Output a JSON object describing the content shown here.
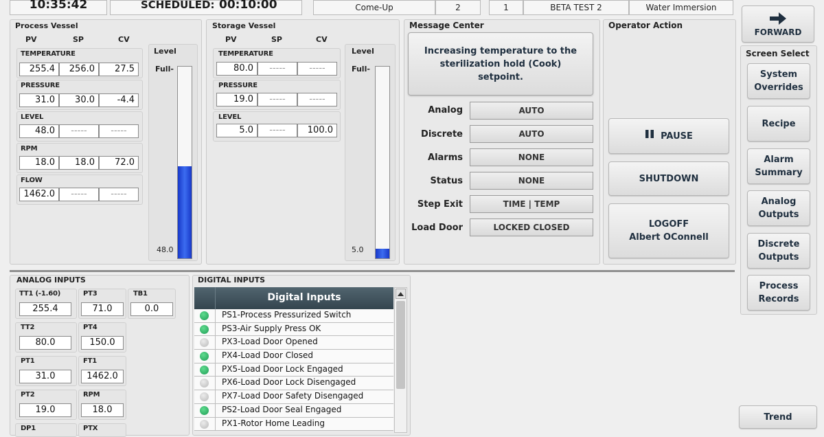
{
  "header": {
    "clock": "10:35:42",
    "scheduled_label": "SCHEDULED:",
    "scheduled_value": "00:10:00",
    "phase": "Come-Up",
    "phase_num": "2",
    "cycle_num": "1",
    "product": "BETA TEST 2",
    "process": "Water Immersion"
  },
  "process_vessel": {
    "title": "Process Vessel",
    "cols": [
      "PV",
      "SP",
      "CV"
    ],
    "rows": [
      {
        "label": "TEMPERATURE",
        "pv": "255.4",
        "sp": "256.0",
        "cv": "27.5"
      },
      {
        "label": "PRESSURE",
        "pv": "31.0",
        "sp": "30.0",
        "cv": "-4.4"
      },
      {
        "label": "LEVEL",
        "pv": "48.0",
        "sp": "-----",
        "cv": "-----"
      },
      {
        "label": "RPM",
        "pv": "18.0",
        "sp": "18.0",
        "cv": "72.0"
      },
      {
        "label": "FLOW",
        "pv": "1462.0",
        "sp": "-----",
        "cv": "-----"
      }
    ],
    "level_title": "Level",
    "level_full": "Full-",
    "level_value": "48.0",
    "level_fraction": 0.48
  },
  "storage_vessel": {
    "title": "Storage Vessel",
    "cols": [
      "PV",
      "SP",
      "CV"
    ],
    "rows": [
      {
        "label": "TEMPERATURE",
        "pv": "80.0",
        "sp": "-----",
        "cv": "-----"
      },
      {
        "label": "PRESSURE",
        "pv": "19.0",
        "sp": "-----",
        "cv": "-----"
      },
      {
        "label": "LEVEL",
        "pv": "5.0",
        "sp": "-----",
        "cv": "100.0"
      }
    ],
    "level_title": "Level",
    "level_full": "Full-",
    "level_value": "5.0",
    "level_fraction": 0.05
  },
  "message_center": {
    "title": "Message Center",
    "message_line1": "Increasing temperature to the",
    "message_line2": "sterilization hold (Cook)",
    "message_line3": "setpoint.",
    "status": [
      {
        "label": "Analog",
        "value": "AUTO"
      },
      {
        "label": "Discrete",
        "value": "AUTO"
      },
      {
        "label": "Alarms",
        "value": "NONE"
      },
      {
        "label": "Status",
        "value": "NONE"
      },
      {
        "label": "Step Exit",
        "value": "TIME | TEMP"
      },
      {
        "label": "Load Door",
        "value": "LOCKED CLOSED"
      }
    ]
  },
  "operator_action": {
    "title": "Operator Action",
    "pause_label": "PAUSE",
    "shutdown_label": "SHUTDOWN",
    "logoff_label": "LOGOFF",
    "user_name": "Albert OConnell"
  },
  "nav": {
    "forward_label": "FORWARD",
    "screen_select_title": "Screen Select",
    "buttons": [
      {
        "line1": "System",
        "line2": "Overrides"
      },
      {
        "line1": "Recipe",
        "line2": ""
      },
      {
        "line1": "Alarm",
        "line2": "Summary"
      },
      {
        "line1": "Analog",
        "line2": "Outputs"
      },
      {
        "line1": "Discrete",
        "line2": "Outputs"
      },
      {
        "line1": "Process",
        "line2": "Records"
      }
    ],
    "trend_label": "Trend"
  },
  "analog_inputs": {
    "title": "ANALOG INPUTS",
    "items": [
      {
        "label": "TT1 (-1.60)",
        "value": "255.4"
      },
      {
        "label": "PT3",
        "value": "71.0"
      },
      {
        "label": "TB1",
        "value": "0.0"
      },
      {
        "label": "TT2",
        "value": "80.0"
      },
      {
        "label": "PT4",
        "value": "150.0"
      },
      {
        "label": "PT1",
        "value": "31.0"
      },
      {
        "label": "FT1",
        "value": "1462.0"
      },
      {
        "label": "PT2",
        "value": "19.0"
      },
      {
        "label": "RPM",
        "value": "18.0"
      },
      {
        "label": "DP1",
        "value": ""
      },
      {
        "label": "PTX",
        "value": ""
      }
    ]
  },
  "digital_inputs": {
    "title": "DIGITAL INPUTS",
    "table_header": "Digital Inputs",
    "items": [
      {
        "label": "PS1-Process Pressurized Switch",
        "on": true
      },
      {
        "label": "PS3-Air Supply Press OK",
        "on": true
      },
      {
        "label": "PX3-Load Door Opened",
        "on": false
      },
      {
        "label": "PX4-Load Door Closed",
        "on": true
      },
      {
        "label": "PX5-Load Door Lock Engaged",
        "on": true
      },
      {
        "label": "PX6-Load Door Lock Disengaged",
        "on": false
      },
      {
        "label": "PX7-Load Door Safety Disengaged",
        "on": false
      },
      {
        "label": "PS2-Load Door Seal Engaged",
        "on": true
      },
      {
        "label": "PX1-Rotor Home Leading",
        "on": false
      }
    ]
  }
}
